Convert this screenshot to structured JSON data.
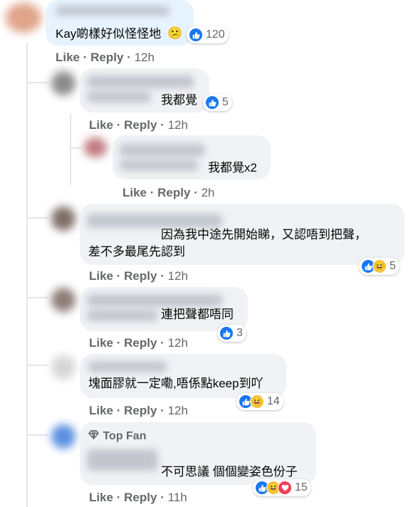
{
  "colors": {
    "like_blue": "#1877f2",
    "bubble_grey": "#f0f2f5",
    "bubble_highlight": "#e7f3ff",
    "meta_grey": "#65676b"
  },
  "comments": [
    {
      "text": "Kay啲樣好似怪怪地",
      "emoji": "confused-face-emoji",
      "reactions": [
        "like"
      ],
      "reaction_count": "120",
      "actions": {
        "like": "Like",
        "reply": "Reply",
        "time": "12h"
      }
    },
    {
      "text": "我都覺",
      "reactions": [
        "like"
      ],
      "reaction_count": "5",
      "actions": {
        "like": "Like",
        "reply": "Reply",
        "time": "12h"
      }
    },
    {
      "text": "我都覺x2",
      "reactions": [],
      "reaction_count": "",
      "actions": {
        "like": "Like",
        "reply": "Reply",
        "time": "2h"
      }
    },
    {
      "text_line1": "因為我中途先開始睇，又認唔到把聲，",
      "text_line2": "差不多最尾先認到",
      "reactions": [
        "like",
        "haha"
      ],
      "reaction_count": "5",
      "actions": {
        "like": "Like",
        "reply": "Reply",
        "time": "12h"
      }
    },
    {
      "text": "連把聲都唔同",
      "reactions": [
        "like"
      ],
      "reaction_count": "3",
      "actions": {
        "like": "Like",
        "reply": "Reply",
        "time": "12h"
      }
    },
    {
      "text": "塊面膠就一定嘞,唔係點keep到吖",
      "reactions": [
        "like",
        "haha"
      ],
      "reaction_count": "14",
      "actions": {
        "like": "Like",
        "reply": "Reply",
        "time": "12h"
      }
    },
    {
      "badge": "Top Fan",
      "badge_icon": "diamond-icon",
      "text": "不可思議 個個變姿色份子",
      "reactions": [
        "like",
        "haha",
        "love"
      ],
      "reaction_count": "15",
      "actions": {
        "like": "Like",
        "reply": "Reply",
        "time": "11h"
      }
    }
  ]
}
